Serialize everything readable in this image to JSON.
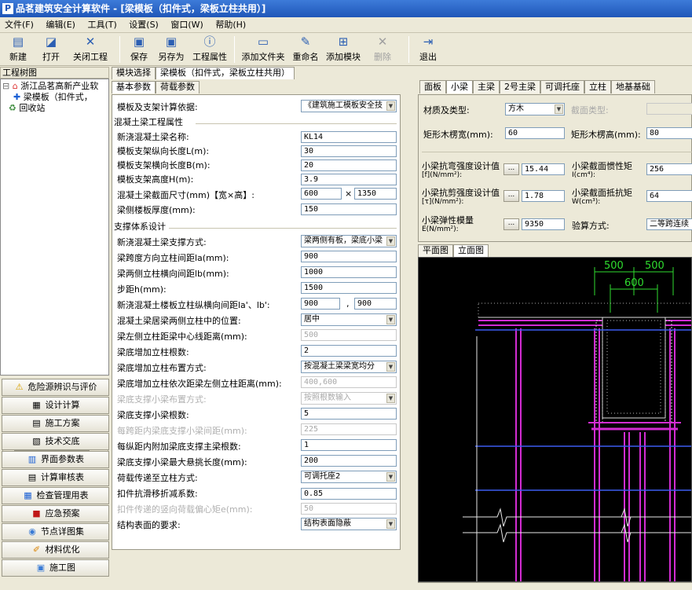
{
  "window": {
    "title": "品茗建筑安全计算软件 - [梁模板（扣件式，梁板立柱共用）]",
    "logo_char": "P"
  },
  "menu": [
    "文件(F)",
    "编辑(E)",
    "工具(T)",
    "设置(S)",
    "窗口(W)",
    "帮助(H)"
  ],
  "toolbar": {
    "new": "新建",
    "open": "打开",
    "close_project": "关闭工程",
    "save": "保存",
    "save_as": "另存为",
    "project_props": "工程属性",
    "add_folder": "添加文件夹",
    "rename": "重命名",
    "add_module": "添加模块",
    "delete": "删除",
    "exit": "退出"
  },
  "left": {
    "header": "工程树图",
    "tree": [
      "浙江品茗高新产业软",
      "梁模板（扣件式，",
      "回收站"
    ],
    "buttons": [
      "危险源辨识与评价",
      "设计计算",
      "施工方案",
      "技术交底",
      "界面参数表",
      "计算审核表",
      "检查管理用表",
      "应急预案",
      "节点详图集",
      "材料优化",
      "施工图"
    ]
  },
  "doc_tabs": [
    "模块选择",
    "梁模板（扣件式，梁板立柱共用）"
  ],
  "param_tabs": [
    "基本参数",
    "荷载参数"
  ],
  "form": {
    "basis_label": "模板及支架计算依据:",
    "basis_value": "《建筑施工模板安全技",
    "group1": "混凝土梁工程属性",
    "beam_name_label": "新浇混凝土梁名称:",
    "beam_name": "KL14",
    "span_l_label": "模板支架纵向长度L(m):",
    "span_l": "30",
    "span_b_label": "模板支架横向长度B(m):",
    "span_b": "20",
    "height_label": "模板支架高度H(m):",
    "height": "3.9",
    "section_label": "混凝土梁截面尺寸(mm)【宽×高】:",
    "section_w": "600",
    "section_x": "×",
    "section_h": "1350",
    "slab_label": "梁侧楼板厚度(mm):",
    "slab": "150",
    "group2": "支撑体系设计",
    "support_mode_label": "新浇混凝土梁支撑方式:",
    "support_mode": "梁两侧有板，梁底小梁",
    "la_label": "梁跨度方向立柱间距la(mm):",
    "la": "900",
    "lb_label": "梁两侧立柱横向间距lb(mm):",
    "lb": "1000",
    "step_label": "步距h(mm):",
    "step": "1500",
    "slab_pole_label": "新浇混凝土楼板立柱纵横向间距la'、lb':",
    "slab_pole_1": "900",
    "slab_pole_sep": ",",
    "slab_pole_2": "900",
    "mid_pos_label": "混凝土梁居梁两侧立柱中的位置:",
    "mid_pos": "居中",
    "left_dist_label": "梁左侧立柱距梁中心线距离(mm):",
    "left_dist": "500",
    "add_cnt_label": "梁底增加立柱根数:",
    "add_cnt": "2",
    "add_arr_label": "梁底增加立柱布置方式:",
    "add_arr": "按混凝土梁梁宽均分",
    "add_dist_label": "梁底增加立柱依次距梁左侧立柱距离(mm):",
    "add_dist": "400,600",
    "small_beam_mode_label": "梁底支撑小梁布置方式:",
    "small_beam_mode": "按照根数输入",
    "small_beam_cnt_label": "梁底支撑小梁根数:",
    "small_beam_cnt": "5",
    "small_beam_spacing_label": "每跨距内梁底支撑小梁间距(mm):",
    "small_beam_spacing": "225",
    "main_beam_label": "每纵距内附加梁底支撑主梁根数:",
    "main_beam": "1",
    "cantilever_label": "梁底支撑小梁最大悬挑长度(mm):",
    "cantilever": "200",
    "load_mode_label": "荷载传递至立柱方式:",
    "load_mode": "可调托座2",
    "slip_label": "扣件抗滑移折减系数:",
    "slip": "0.85",
    "ecc_label": "扣件传递的竖向荷载偏心矩e(mm):",
    "ecc": "50",
    "surface_label": "结构表面的要求:",
    "surface": "结构表面隐蔽"
  },
  "right_tabs": [
    "面板",
    "小梁",
    "主梁",
    "2号主梁",
    "可调托座",
    "立柱",
    "地基基础"
  ],
  "right": {
    "mat_label": "材质及类型:",
    "mat": "方木",
    "section_type_label": "截面类型:",
    "rect_w_label": "矩形木楞宽(mm):",
    "rect_w": "60",
    "rect_h_label": "矩形木楞高(mm):",
    "rect_h": "80",
    "f_label": "小梁抗弯强度设计值",
    "f_unit": "[f](N/mm²):",
    "f_val": "15.44",
    "i_label": "小梁截面惯性矩",
    "i_unit": "I(cm⁴):",
    "i_val": "256",
    "tau_label": "小梁抗剪强度设计值",
    "tau_unit": "[τ](N/mm²):",
    "tau_val": "1.78",
    "w_label": "小梁截面抵抗矩",
    "w_unit": "W(cm³):",
    "w_val": "64",
    "e_label": "小梁弹性模量",
    "e_unit": "E(N/mm²):",
    "e_val": "9350",
    "calc_label": "验算方式:",
    "calc_val": "二等跨连续",
    "dots": "..."
  },
  "view_tabs": [
    "平面图",
    "立面图"
  ],
  "drawing": {
    "dim_a": "500",
    "dim_b": "500",
    "dim_c": "600"
  }
}
